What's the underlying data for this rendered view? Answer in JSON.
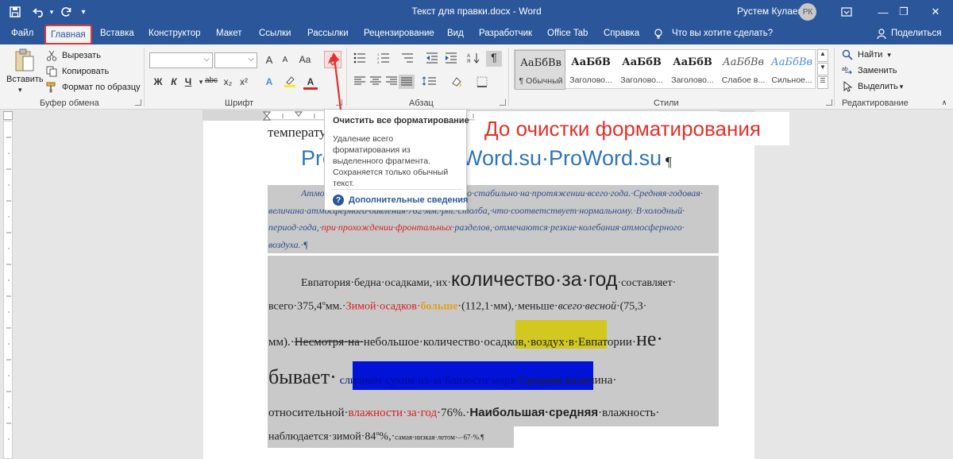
{
  "titlebar": {
    "doc_title": "Текст для правки.docx - Word",
    "user_name": "Рустем Кулаев",
    "avatar_initials": "РК",
    "save_icon": "save-icon",
    "undo_icon": "undo-icon",
    "redo_icon": "redo-icon",
    "customize_icon": "qat-dropdown-icon",
    "ribbon_options_icon": "ribbon-display-icon",
    "minimize": "—",
    "restore": "❐",
    "close": "✕"
  },
  "tabs": {
    "file": "Файл",
    "home": "Главная",
    "insert": "Вставка",
    "design": "Конструктор",
    "layout": "Макет",
    "references": "Ссылки",
    "mailings": "Рассылки",
    "review": "Рецензирование",
    "view": "Вид",
    "developer": "Разработчик",
    "officetab": "Office Tab",
    "help": "Справка",
    "tell_me": "Что вы хотите сделать?",
    "share": "Поделиться"
  },
  "ribbon": {
    "clipboard": {
      "paste": "Вставить",
      "cut": "Вырезать",
      "copy": "Копировать",
      "format_painter": "Формат по образцу",
      "label": "Буфер обмена"
    },
    "font": {
      "label": "Шрифт",
      "grow": "A",
      "shrink": "A",
      "case": "Aa",
      "bold": "Ж",
      "italic": "К",
      "underline": "Ч",
      "strike": "abc",
      "subscript": "x₂",
      "superscript": "x²",
      "text_effects": "A",
      "font_color": "A"
    },
    "paragraph": {
      "label": "Абзац",
      "pilcrow": "¶"
    },
    "styles": {
      "label": "Стили",
      "items": [
        {
          "sample": "АаБбВв",
          "name": "¶ Обычный"
        },
        {
          "sample": "АаБбВ",
          "name": "Заголово..."
        },
        {
          "sample": "АаБбВ",
          "name": "Заголово..."
        },
        {
          "sample": "АаБбВ",
          "name": "Заголово..."
        },
        {
          "sample": "АаБбВв",
          "name": "Слабое в..."
        },
        {
          "sample": "АаБбВв",
          "name": "Сильное..."
        }
      ]
    },
    "editing": {
      "label": "Редактирование",
      "find": "Найти",
      "replace": "Заменить",
      "select": "Выделить"
    }
  },
  "tooltip": {
    "title": "Очистить все форматирование",
    "description": "Удаление всего форматирования из выделенного фрагмента. Сохраняется только обычный текст.",
    "more_info": "Дополнительные сведения"
  },
  "annotation": "До очистки форматирования",
  "document": {
    "line0": "температу",
    "heading_left": "Pro",
    "heading_right": "Word.su·ProWord.su",
    "heading_mark": "¶",
    "p1_l1a": "Атмо",
    "p1_l1b": "о·стабильно·на·протяжении·всего·года.·Средняя·годовая·",
    "p1_l2": "величина·атмосферного·давления·762·мм.·рт.·столба,·что·соответствует·нормальному.·В·холодный·",
    "p1_l3a": "период·года,·",
    "p1_l3b": "при·прохождении·фронтальных",
    "p1_l3c": "·разделов,·отмечаются·резкие·колебания·атмосферного·",
    "p1_l4": "воздуха.·¶",
    "p2_l1a": "Евпатория·бедна·осадками,·их·",
    "p2_l1b": "количество·за·год",
    "p2_l1c": "·составляет·",
    "p2_l2a": "всего·375,4",
    "p2_l2sup": "о",
    "p2_l2b": "мм.·",
    "p2_l2c": "Зимой·осадков·",
    "p2_l2d": "больше",
    "p2_l2e": "·(112,1·мм),·меньше·",
    "p2_l2f": "всего·весной",
    "p2_l2g": "·(75,3·",
    "p2_l3a": "мм).·",
    "p2_l3b": "Несмотря·на·",
    "p2_l3c": "небольшое·количество·",
    "p2_l3d": "осадков,·воздух",
    "p2_l3e": "·в·Евпатории·",
    "p2_l3f": "не·",
    "p2_l4a": "бывает·",
    "p2_l4b": "слишком·сухим·из-за·близости·моря",
    "p2_l4c": "·Средняя·величина·",
    "p2_l5a": "относительной·",
    "p2_l5b": "влажности·за·год",
    "p2_l5c": "·76%.·",
    "p2_l5d": "Наибольшая·средняя",
    "p2_l5e": "·влажность·",
    "p2_l6a": "наблюдается·зимой·84",
    "p2_l6sup": "о",
    "p2_l6b": "%,·",
    "p2_l6c": "самая·низкая·летом·–·67·%.¶"
  }
}
